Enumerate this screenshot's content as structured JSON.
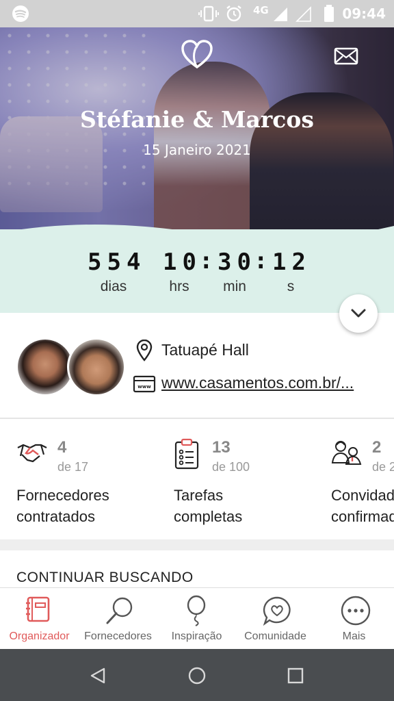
{
  "status_bar": {
    "time": "09:44",
    "network": "4G"
  },
  "hero": {
    "couple_name": "Stéfanie & Marcos",
    "date": "15 Janeiro 2021"
  },
  "countdown": {
    "days": "554",
    "hours": "10",
    "minutes": "30",
    "seconds": "12",
    "days_label": "dias",
    "hours_label": "hrs",
    "minutes_label": "min",
    "seconds_label": "s"
  },
  "info": {
    "venue": "Tatuapé Hall",
    "website": "www.casamentos.com.br/..."
  },
  "stats": [
    {
      "count": "4",
      "of": "de 17",
      "label_line1": "Fornecedores",
      "label_line2": "contratados"
    },
    {
      "count": "13",
      "of": "de 100",
      "label_line1": "Tarefas",
      "label_line2": "completas"
    },
    {
      "count": "2",
      "of": "de 2",
      "label_line1": "Convidados",
      "label_line2": "confirmados"
    }
  ],
  "section": {
    "continue_title": "CONTINUAR BUSCANDO"
  },
  "bottom_nav": [
    {
      "label": "Organizador",
      "icon": "planner-icon",
      "active": true
    },
    {
      "label": "Fornecedores",
      "icon": "search-icon"
    },
    {
      "label": "Inspiração",
      "icon": "balloon-icon"
    },
    {
      "label": "Comunidade",
      "icon": "chat-heart-icon"
    },
    {
      "label": "Mais",
      "icon": "more-icon"
    }
  ],
  "colors": {
    "accent": "#e05a5a",
    "countdown_bg": "#dcf0ea",
    "nav_text": "#666666"
  }
}
